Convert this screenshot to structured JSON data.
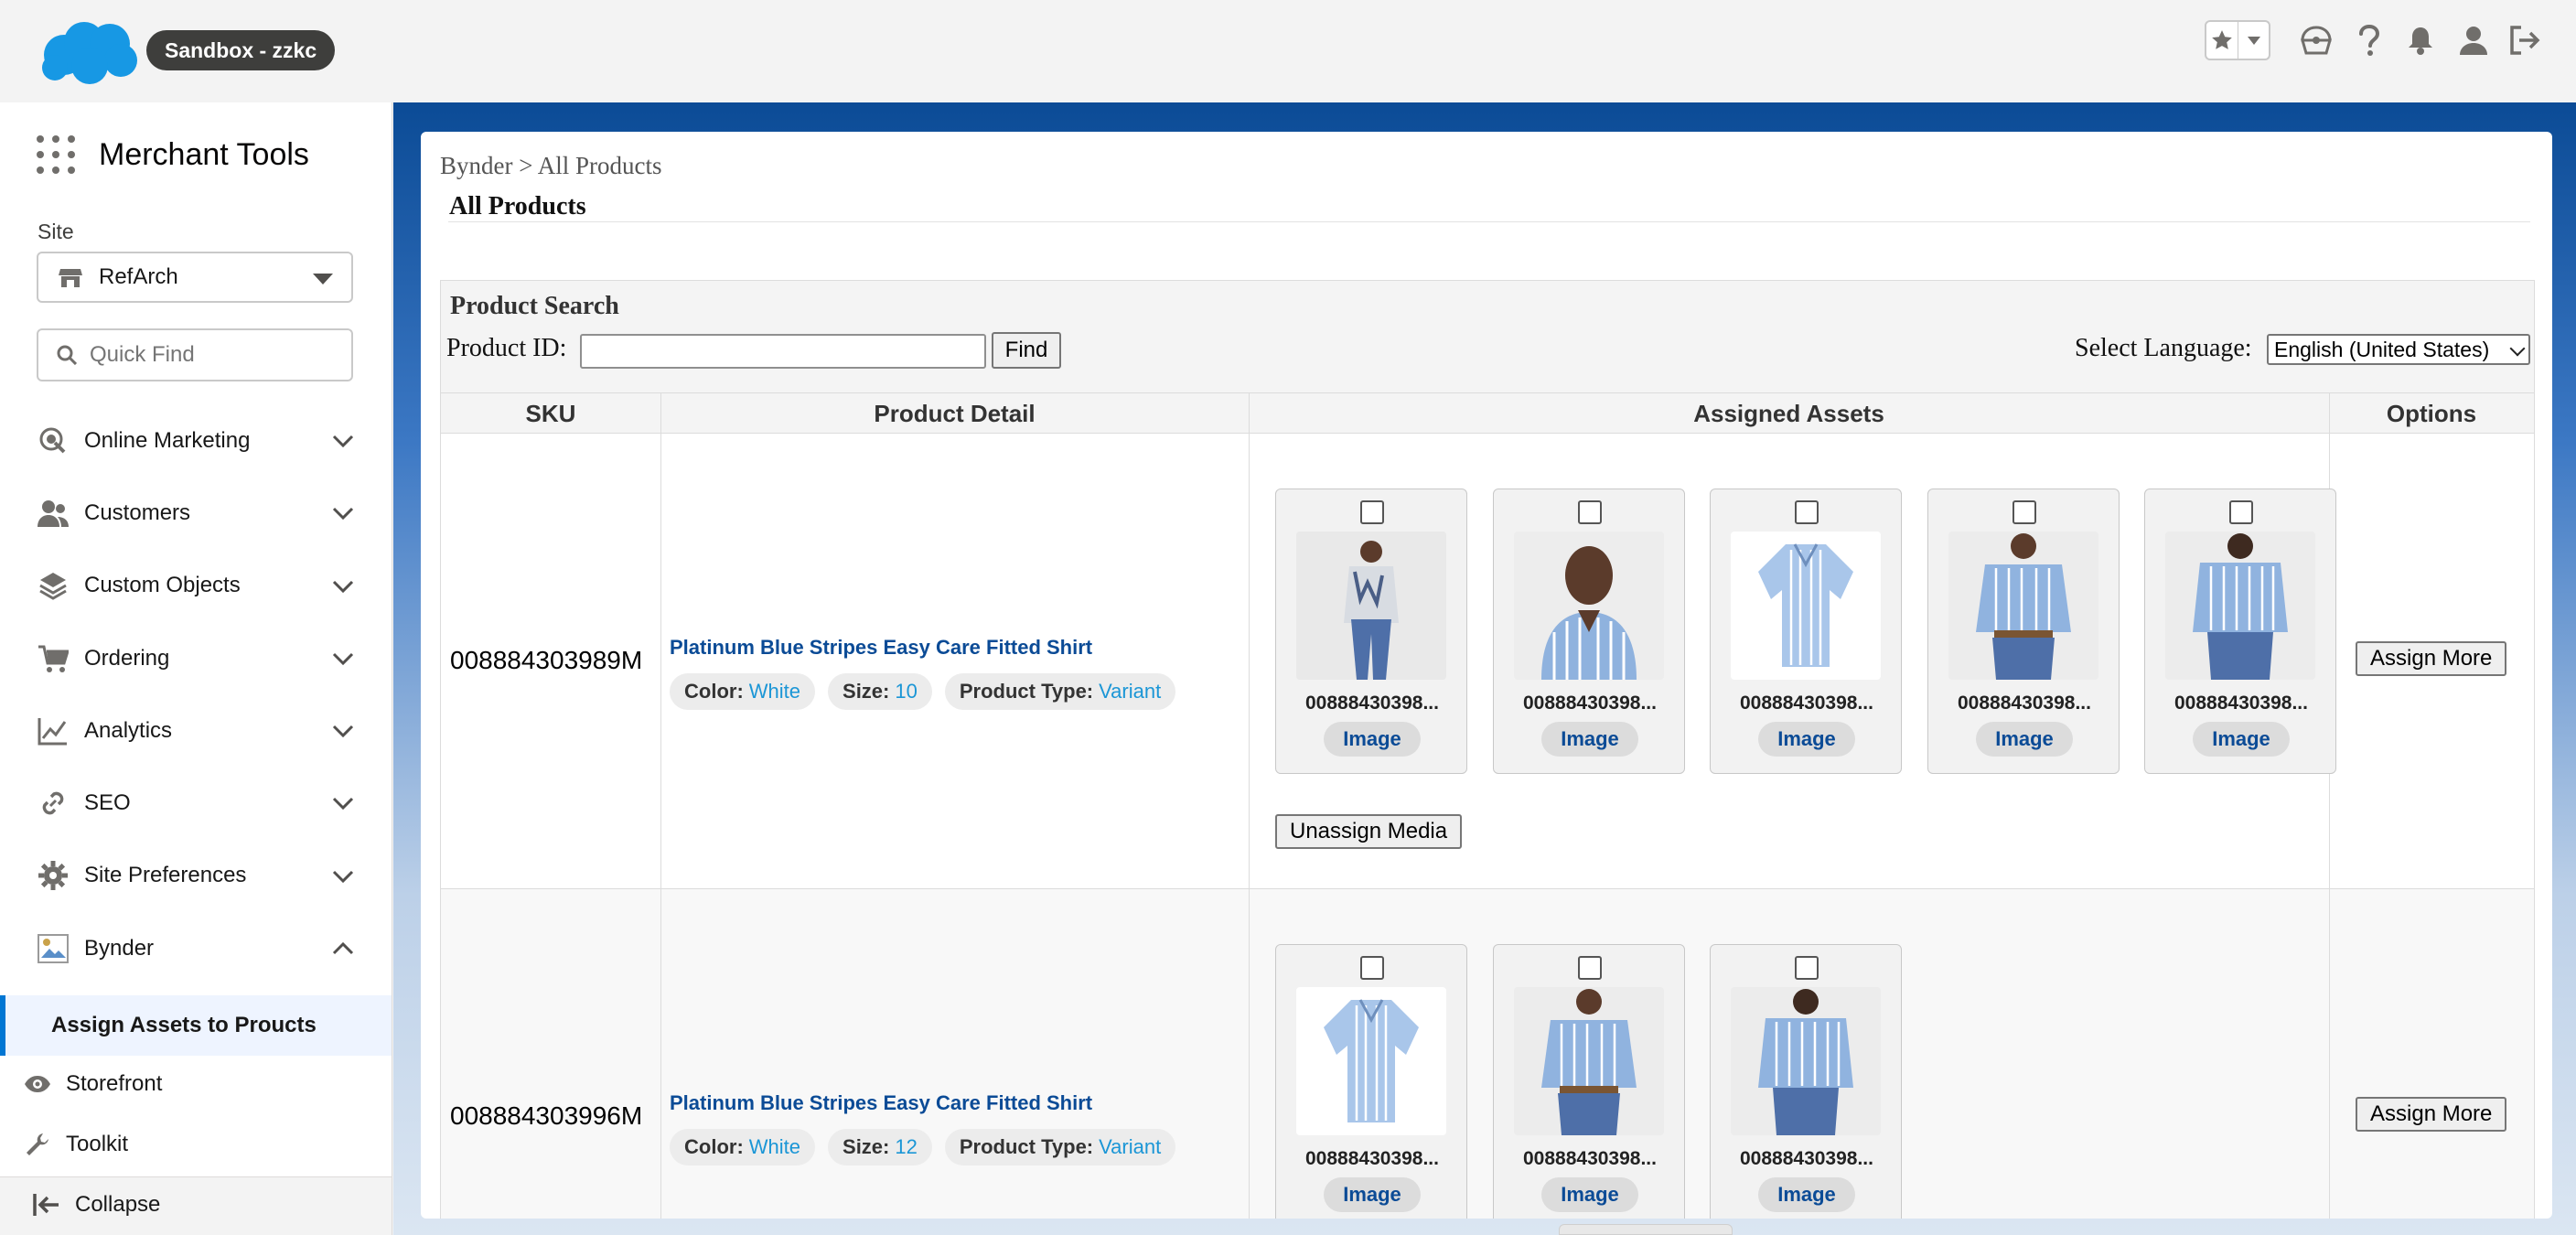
{
  "header": {
    "sandbox_label": "Sandbox - zzkc",
    "icons": [
      "favorites-star-icon",
      "favorites-dropdown-icon",
      "trailhead-icon",
      "help-icon",
      "notifications-icon",
      "user-icon",
      "logout-icon"
    ]
  },
  "sidebar": {
    "app_name": "Merchant Tools",
    "site_label": "Site",
    "site_value": "RefArch",
    "quick_find_placeholder": "Quick Find",
    "items": [
      {
        "label": "Online Marketing",
        "icon": "marketing-icon"
      },
      {
        "label": "Customers",
        "icon": "customers-icon"
      },
      {
        "label": "Custom Objects",
        "icon": "layers-icon"
      },
      {
        "label": "Ordering",
        "icon": "cart-icon"
      },
      {
        "label": "Analytics",
        "icon": "chart-icon"
      },
      {
        "label": "SEO",
        "icon": "link-icon"
      },
      {
        "label": "Site Preferences",
        "icon": "gear-icon"
      },
      {
        "label": "Bynder",
        "icon": "bynder-icon"
      }
    ],
    "active_sub": "Assign Assets to Proucts",
    "storefront": "Storefront",
    "toolkit": "Toolkit",
    "collapse": "Collapse"
  },
  "main": {
    "breadcrumb": "Bynder > All Products",
    "title": "All Products",
    "search": {
      "heading": "Product Search",
      "product_id_label": "Product ID:",
      "product_id_value": "",
      "find_label": "Find",
      "language_label": "Select Language:",
      "language_value": "English (United States)"
    },
    "columns": [
      "SKU",
      "Product Detail",
      "Assigned Assets",
      "Options"
    ],
    "rows": [
      {
        "sku": "008884303989M",
        "name": "Platinum Blue Stripes Easy Care Fitted Shirt",
        "color_label": "Color:",
        "color": "White",
        "size_label": "Size:",
        "size": "10",
        "type_label": "Product Type:",
        "type": "Variant",
        "assets": [
          {
            "caption": "00888430398...",
            "button": "Image",
            "thumb": "model-floral-jacket-jeans"
          },
          {
            "caption": "00888430398...",
            "button": "Image",
            "thumb": "model-blue-stripe-closeup"
          },
          {
            "caption": "00888430398...",
            "button": "Image",
            "thumb": "shirt-flat-blue-stripe"
          },
          {
            "caption": "00888430398...",
            "button": "Image",
            "thumb": "model-blue-stripe-front"
          },
          {
            "caption": "00888430398...",
            "button": "Image",
            "thumb": "model-blue-stripe-back"
          }
        ],
        "unassign_label": "Unassign Media",
        "assign_more_label": "Assign More"
      },
      {
        "sku": "008884303996M",
        "name": "Platinum Blue Stripes Easy Care Fitted Shirt",
        "color_label": "Color:",
        "color": "White",
        "size_label": "Size:",
        "size": "12",
        "type_label": "Product Type:",
        "type": "Variant",
        "assets": [
          {
            "caption": "00888430398...",
            "button": "Image",
            "thumb": "shirt-flat-blue-stripe"
          },
          {
            "caption": "00888430398...",
            "button": "Image",
            "thumb": "model-blue-stripe-front"
          },
          {
            "caption": "00888430398...",
            "button": "Image",
            "thumb": "model-blue-stripe-back"
          }
        ],
        "assign_more_label": "Assign More"
      }
    ]
  },
  "colors": {
    "brand_blue": "#0176d3",
    "banner_navy": "#0b4b96",
    "link_blue": "#0b4b96",
    "value_blue": "#1b96d6",
    "cloud_blue": "#1798e4"
  }
}
